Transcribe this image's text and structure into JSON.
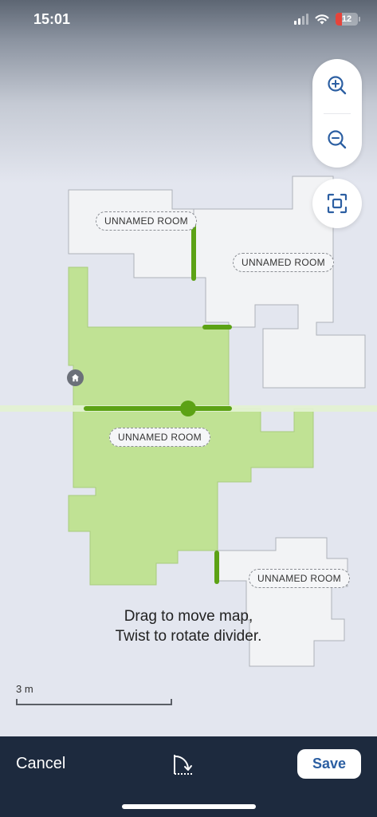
{
  "status_bar": {
    "time": "15:01",
    "battery_level": "12",
    "icons": [
      "signal-icon",
      "wifi-icon",
      "battery-icon"
    ]
  },
  "map": {
    "selected_room_color": "#c0e294",
    "room_color": "#f2f3f5",
    "divider_color": "#5ca215",
    "rooms": [
      {
        "label": "UNNAMED ROOM",
        "selected": false
      },
      {
        "label": "UNNAMED ROOM",
        "selected": false
      },
      {
        "label": "UNNAMED ROOM",
        "selected": true
      },
      {
        "label": "UNNAMED ROOM",
        "selected": false
      }
    ]
  },
  "map_controls": {
    "zoom_in_icon": "zoom-in-icon",
    "zoom_out_icon": "zoom-out-icon",
    "fit_icon": "fit-to-screen-icon"
  },
  "instructions": {
    "line1": "Drag to move map,",
    "line2": "Twist to rotate divider."
  },
  "scale": {
    "label": "3 m"
  },
  "bottom_bar": {
    "cancel_label": "Cancel",
    "rotate_icon": "rotate-divider-icon",
    "save_label": "Save",
    "save_color": "#2c5fa2"
  }
}
